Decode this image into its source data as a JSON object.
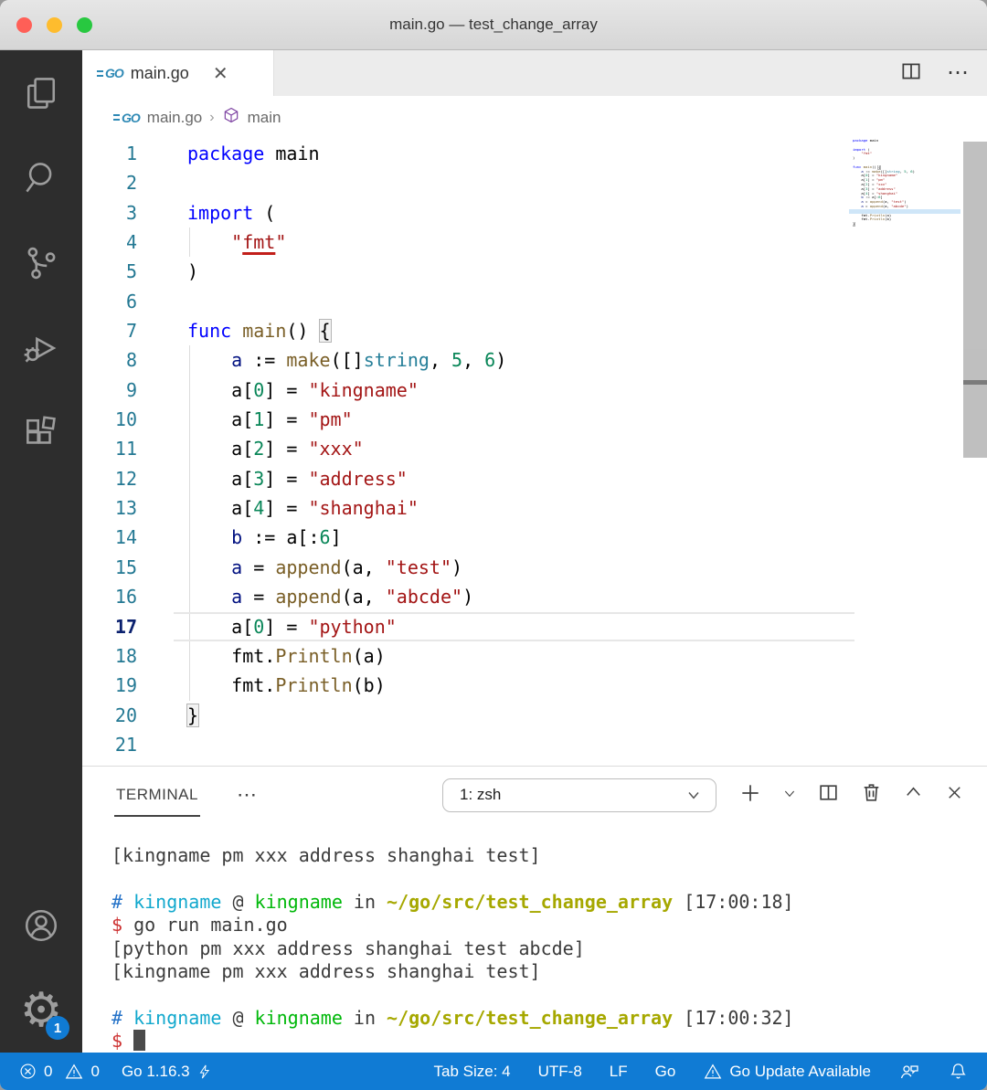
{
  "colors": {
    "accent": "#107bd4",
    "go_logo": "#2e89b5",
    "editor_tokens": {
      "k": "#0000ff",
      "t": "#000000",
      "v": "#001080",
      "f": "#795e26",
      "s": "#a31515",
      "su": "#a31515",
      "n": "#098658",
      "ty": "#267f99",
      "b": "#000000"
    },
    "terminal_tokens": {
      "o": "#3b3b3b",
      "blue": "#2472c8",
      "cyan": "#11a8cd",
      "green": "#00b80a",
      "path": "#a6a800",
      "red": "#cd3131",
      "cursor": "#4a4a4a"
    }
  },
  "window": {
    "title": "main.go — test_change_array"
  },
  "activity_bar": {
    "items": [
      "explorer",
      "search",
      "source-control",
      "run-and-debug",
      "extensions"
    ],
    "bottom_items": [
      "account",
      "settings"
    ],
    "settings_badge": "1"
  },
  "tab_bar": {
    "tab_label": "main.go",
    "close_label": "✕",
    "more_label": "⋯"
  },
  "breadcrumb": {
    "file": "main.go",
    "separator": "›",
    "symbol": "main"
  },
  "editor": {
    "current_line": 17,
    "lines": [
      {
        "n": 1,
        "tokens": [
          [
            "k",
            "package"
          ],
          [
            "t",
            " main"
          ]
        ]
      },
      {
        "n": 2,
        "tokens": []
      },
      {
        "n": 3,
        "tokens": [
          [
            "k",
            "import"
          ],
          [
            "t",
            " ("
          ]
        ]
      },
      {
        "n": 4,
        "tokens": [
          [
            "t",
            "    "
          ],
          [
            "s",
            "\""
          ],
          [
            "su",
            "fmt"
          ],
          [
            "s",
            "\""
          ]
        ]
      },
      {
        "n": 5,
        "tokens": [
          [
            "t",
            ")"
          ]
        ]
      },
      {
        "n": 6,
        "tokens": []
      },
      {
        "n": 7,
        "tokens": [
          [
            "k",
            "func"
          ],
          [
            "t",
            " "
          ],
          [
            "f",
            "main"
          ],
          [
            "t",
            "() "
          ],
          [
            "b",
            "{"
          ]
        ]
      },
      {
        "n": 8,
        "tokens": [
          [
            "t",
            "    "
          ],
          [
            "v",
            "a"
          ],
          [
            "t",
            " := "
          ],
          [
            "f",
            "make"
          ],
          [
            "t",
            "([]"
          ],
          [
            "ty",
            "string"
          ],
          [
            "t",
            ", "
          ],
          [
            "n",
            "5"
          ],
          [
            "t",
            ", "
          ],
          [
            "n",
            "6"
          ],
          [
            "t",
            ")"
          ]
        ]
      },
      {
        "n": 9,
        "tokens": [
          [
            "t",
            "    a["
          ],
          [
            "n",
            "0"
          ],
          [
            "t",
            "] = "
          ],
          [
            "s",
            "\"kingname\""
          ]
        ]
      },
      {
        "n": 10,
        "tokens": [
          [
            "t",
            "    a["
          ],
          [
            "n",
            "1"
          ],
          [
            "t",
            "] = "
          ],
          [
            "s",
            "\"pm\""
          ]
        ]
      },
      {
        "n": 11,
        "tokens": [
          [
            "t",
            "    a["
          ],
          [
            "n",
            "2"
          ],
          [
            "t",
            "] = "
          ],
          [
            "s",
            "\"xxx\""
          ]
        ]
      },
      {
        "n": 12,
        "tokens": [
          [
            "t",
            "    a["
          ],
          [
            "n",
            "3"
          ],
          [
            "t",
            "] = "
          ],
          [
            "s",
            "\"address\""
          ]
        ]
      },
      {
        "n": 13,
        "tokens": [
          [
            "t",
            "    a["
          ],
          [
            "n",
            "4"
          ],
          [
            "t",
            "] = "
          ],
          [
            "s",
            "\"shanghai\""
          ]
        ]
      },
      {
        "n": 14,
        "tokens": [
          [
            "t",
            "    "
          ],
          [
            "v",
            "b"
          ],
          [
            "t",
            " := a[:"
          ],
          [
            "n",
            "6"
          ],
          [
            "t",
            "]"
          ]
        ]
      },
      {
        "n": 15,
        "tokens": [
          [
            "t",
            "    "
          ],
          [
            "v",
            "a"
          ],
          [
            "t",
            " = "
          ],
          [
            "f",
            "append"
          ],
          [
            "t",
            "(a, "
          ],
          [
            "s",
            "\"test\""
          ],
          [
            "t",
            ")"
          ]
        ]
      },
      {
        "n": 16,
        "tokens": [
          [
            "t",
            "    "
          ],
          [
            "v",
            "a"
          ],
          [
            "t",
            " = "
          ],
          [
            "f",
            "append"
          ],
          [
            "t",
            "(a, "
          ],
          [
            "s",
            "\"abcde\""
          ],
          [
            "t",
            ")"
          ]
        ]
      },
      {
        "n": 17,
        "tokens": [
          [
            "t",
            "    a["
          ],
          [
            "n",
            "0"
          ],
          [
            "t",
            "] = "
          ],
          [
            "s",
            "\"python\""
          ]
        ]
      },
      {
        "n": 18,
        "tokens": [
          [
            "t",
            "    fmt."
          ],
          [
            "f",
            "Println"
          ],
          [
            "t",
            "(a)"
          ]
        ]
      },
      {
        "n": 19,
        "tokens": [
          [
            "t",
            "    fmt."
          ],
          [
            "f",
            "Println"
          ],
          [
            "t",
            "(b)"
          ]
        ]
      },
      {
        "n": 20,
        "tokens": [
          [
            "b",
            "}"
          ]
        ]
      },
      {
        "n": 21,
        "tokens": []
      }
    ]
  },
  "terminal": {
    "title": "TERMINAL",
    "more_label": "⋯",
    "dropdown_value": "1: zsh",
    "lines": [
      {
        "tokens": [
          [
            "o",
            "[kingname pm xxx address shanghai test]"
          ]
        ]
      },
      {
        "tokens": []
      },
      {
        "tokens": [
          [
            "blue",
            "#"
          ],
          [
            "o",
            " "
          ],
          [
            "cyan",
            "kingname"
          ],
          [
            "o",
            " @ "
          ],
          [
            "green",
            "kingname"
          ],
          [
            "o",
            " in "
          ],
          [
            "path",
            "~/go/src/test_change_array"
          ],
          [
            "o",
            " [17:00:18]"
          ]
        ]
      },
      {
        "tokens": [
          [
            "red",
            "$"
          ],
          [
            "o",
            " go run main.go"
          ]
        ]
      },
      {
        "tokens": [
          [
            "o",
            "[python pm xxx address shanghai test abcde]"
          ]
        ]
      },
      {
        "tokens": [
          [
            "o",
            "[kingname pm xxx address shanghai test]"
          ]
        ]
      },
      {
        "tokens": []
      },
      {
        "tokens": [
          [
            "blue",
            "#"
          ],
          [
            "o",
            " "
          ],
          [
            "cyan",
            "kingname"
          ],
          [
            "o",
            " @ "
          ],
          [
            "green",
            "kingname"
          ],
          [
            "o",
            " in "
          ],
          [
            "path",
            "~/go/src/test_change_array"
          ],
          [
            "o",
            " [17:00:32]"
          ]
        ]
      },
      {
        "tokens": [
          [
            "red",
            "$"
          ],
          [
            "o",
            " "
          ],
          [
            "cursor",
            "█"
          ]
        ]
      }
    ]
  },
  "status_bar": {
    "errors": "0",
    "warnings": "0",
    "go_version": "Go 1.16.3",
    "tab_size": "Tab Size: 4",
    "encoding": "UTF-8",
    "eol": "LF",
    "language": "Go",
    "update": "Go Update Available"
  }
}
